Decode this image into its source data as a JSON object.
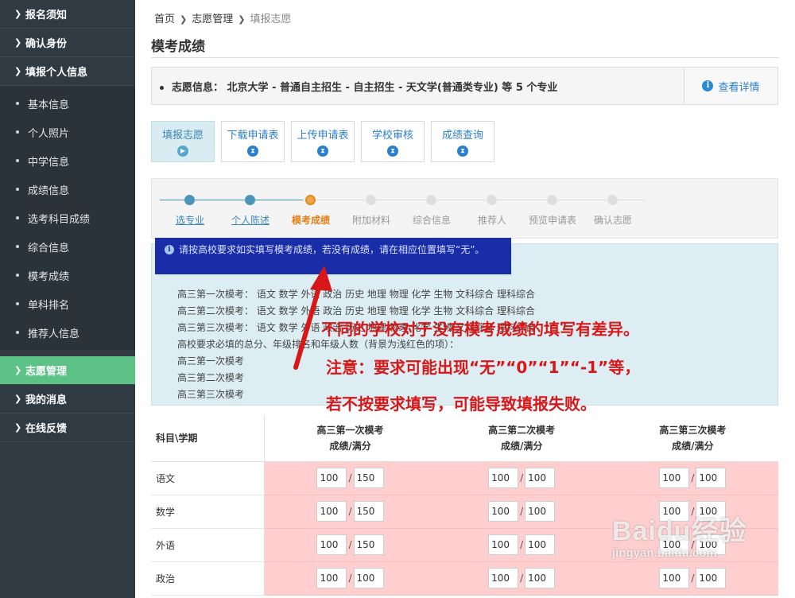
{
  "sidebar": {
    "top_items": [
      {
        "label": "报名须知"
      },
      {
        "label": "确认身份"
      },
      {
        "label": "填报个人信息"
      }
    ],
    "sub_items": [
      {
        "label": "基本信息"
      },
      {
        "label": "个人照片"
      },
      {
        "label": "中学信息"
      },
      {
        "label": "成绩信息"
      },
      {
        "label": "选考科目成绩"
      },
      {
        "label": "综合信息"
      },
      {
        "label": "模考成绩"
      },
      {
        "label": "单科排名"
      },
      {
        "label": "推荐人信息"
      }
    ],
    "bottom_items": [
      {
        "label": "志愿管理",
        "active": true
      },
      {
        "label": "我的消息"
      },
      {
        "label": "在线反馈"
      }
    ],
    "active_color": "#5cc285"
  },
  "breadcrumb": {
    "home": "首页",
    "section": "志愿管理",
    "current": "填报志愿"
  },
  "page_title": "模考成绩",
  "info": {
    "prefix": "志愿信息：",
    "text": "北京大学 - 普通自主招生 - 自主招生 - 天文学(普通类专业) 等 5 个专业",
    "link": "查看详情"
  },
  "steps": [
    {
      "label": "填报志愿",
      "active": true
    },
    {
      "label": "下载申请表"
    },
    {
      "label": "上传申请表"
    },
    {
      "label": "学校审核"
    },
    {
      "label": "成绩查询"
    }
  ],
  "progress": {
    "items": [
      {
        "label": "选专业",
        "state": "done"
      },
      {
        "label": "个人陈述",
        "state": "done"
      },
      {
        "label": "模考成绩",
        "state": "current"
      },
      {
        "label": "附加材料",
        "state": "todo"
      },
      {
        "label": "综合信息",
        "state": "todo"
      },
      {
        "label": "推荐人",
        "state": "todo"
      },
      {
        "label": "预览申请表",
        "state": "todo"
      },
      {
        "label": "确认志愿",
        "state": "todo"
      }
    ]
  },
  "notice": {
    "headline": "请按高校要求如实填写模考成绩，若没有成绩，请在相应位置填写“无”。",
    "lines": [
      {
        "label": "高三第一次模考：",
        "subjects": "语文 数学 外语 政治 历史 地理 物理 化学 生物 文科综合 理科综合"
      },
      {
        "label": "高三第二次模考：",
        "subjects": "语文 数学 外语 政治 历史 地理 物理 化学 生物 文科综合 理科综合"
      },
      {
        "label": "高三第三次模考：",
        "subjects": "语文 数学 外语 政治 历史 地理 物理 化学 生物 文科综合 理科综合"
      },
      {
        "label": "高校要求必填的总分、年级排名和年级人数（背景为浅红色的项）：",
        "subjects": ""
      },
      {
        "label": "高三第一次模考",
        "subjects": ""
      },
      {
        "label": "高三第二次模考",
        "subjects": ""
      },
      {
        "label": "高三第三次模考",
        "subjects": ""
      }
    ]
  },
  "annotation": {
    "line1": "不同的学校对于没有模考成绩的填写有差异。",
    "line2": "注意：要求可能出现“无”“0”“1”“-1”等，",
    "line3": "若不按要求填写，可能导致填报失败。"
  },
  "table": {
    "corner": "科目\\学期",
    "columns": [
      {
        "title": "高三第一次模考",
        "sub": "成绩/满分"
      },
      {
        "title": "高三第二次模考",
        "sub": "成绩/满分"
      },
      {
        "title": "高三第三次模考",
        "sub": "成绩/满分"
      }
    ],
    "rows": [
      {
        "subject": "语文",
        "cells": [
          [
            "100",
            "150"
          ],
          [
            "100",
            "100"
          ],
          [
            "100",
            "100"
          ]
        ]
      },
      {
        "subject": "数学",
        "cells": [
          [
            "100",
            "150"
          ],
          [
            "100",
            "100"
          ],
          [
            "100",
            "100"
          ]
        ]
      },
      {
        "subject": "外语",
        "cells": [
          [
            "100",
            "150"
          ],
          [
            "100",
            "100"
          ],
          [
            "100",
            "100"
          ]
        ]
      },
      {
        "subject": "政治",
        "cells": [
          [
            "100",
            "100"
          ],
          [
            "100",
            "100"
          ],
          [
            "100",
            "100"
          ]
        ]
      }
    ]
  },
  "watermark": {
    "main": "Baidu经验",
    "sub": "jingyan.baidu.com"
  }
}
